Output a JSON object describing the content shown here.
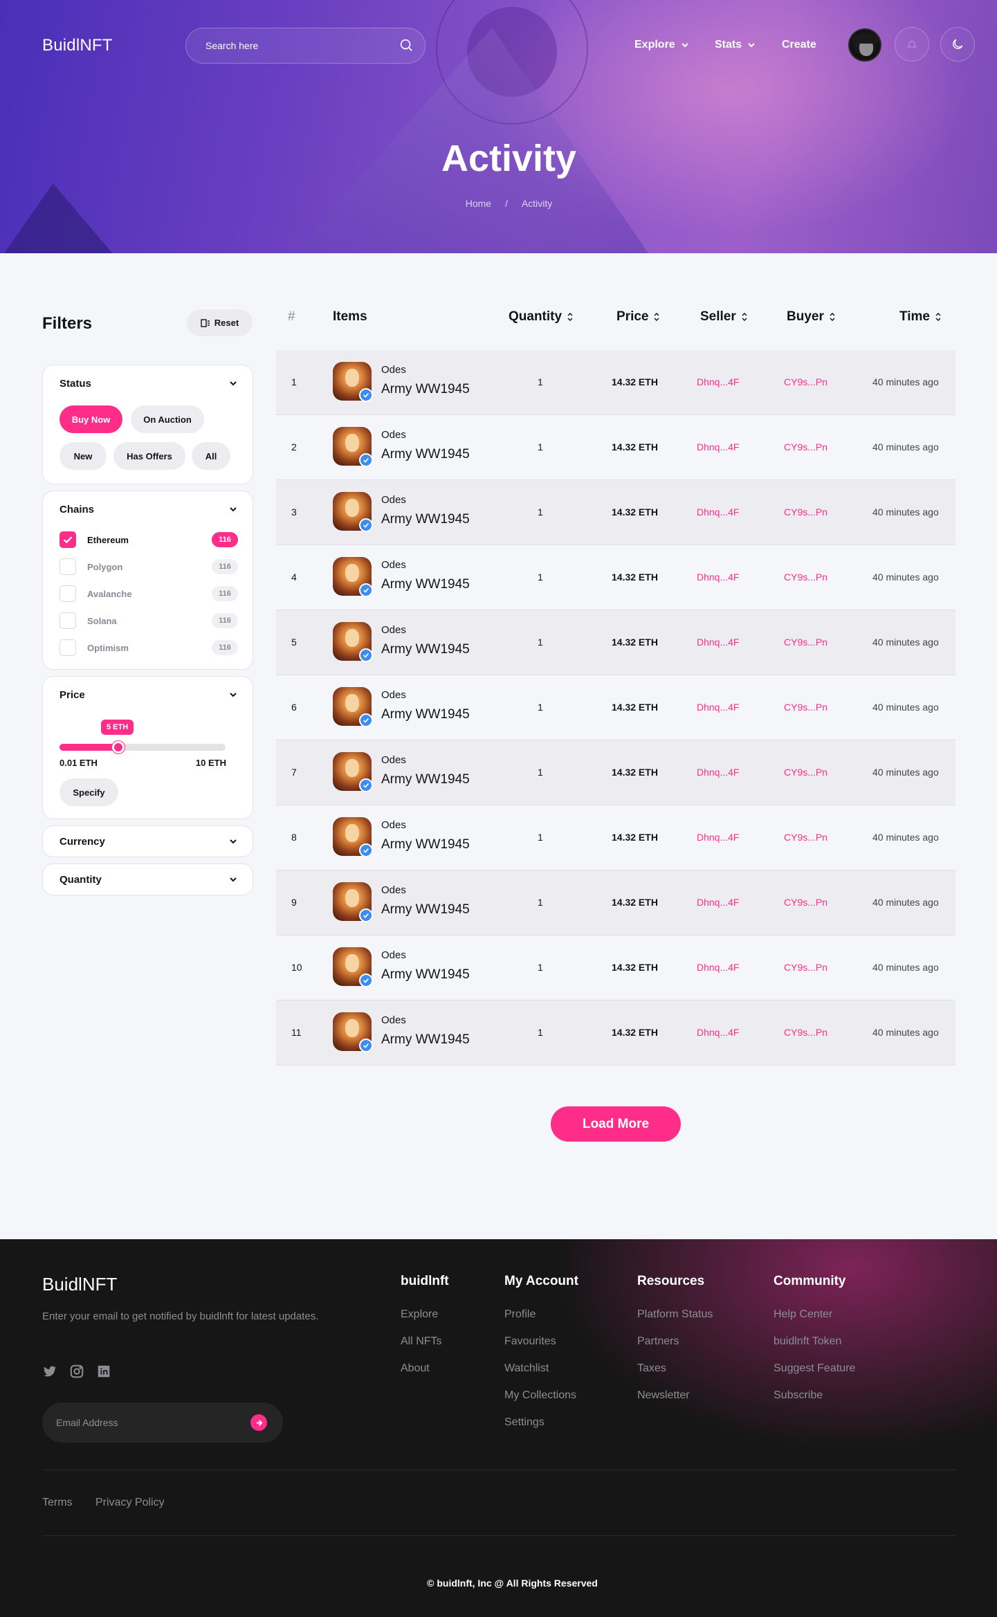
{
  "header": {
    "brand": "BuidlNFT",
    "search_placeholder": "Search here",
    "nav": [
      {
        "label": "Explore"
      },
      {
        "label": "Stats"
      },
      {
        "label": "Create"
      }
    ]
  },
  "hero": {
    "title": "Activity",
    "breadcrumb": [
      "Home",
      "/",
      "Activity"
    ]
  },
  "filters": {
    "title": "Filters",
    "reset_label": "Reset",
    "status": {
      "label": "Status",
      "chips": [
        "Buy Now",
        "On Auction",
        "New",
        "Has Offers",
        "All"
      ],
      "selected": "Buy Now"
    },
    "chains": {
      "label": "Chains",
      "items": [
        {
          "name": "Ethereum",
          "count": "116",
          "checked": true
        },
        {
          "name": "Polygon",
          "count": "116",
          "checked": false
        },
        {
          "name": "Avalanche",
          "count": "116",
          "checked": false
        },
        {
          "name": "Solana",
          "count": "116",
          "checked": false
        },
        {
          "name": "Optimism",
          "count": "116",
          "checked": false
        }
      ]
    },
    "price": {
      "label": "Price",
      "tooltip": "5 ETH",
      "min_label": "0.01 ETH",
      "max_label": "10 ETH",
      "fill_fraction": 0.5,
      "specify_label": "Specify"
    },
    "currency_label": "Currency",
    "quantity_label": "Quantity"
  },
  "table": {
    "headers": {
      "num": "#",
      "items": "Items",
      "quantity": "Quantity",
      "price": "Price",
      "seller": "Seller",
      "buyer": "Buyer",
      "time": "Time"
    },
    "rows": [
      {
        "num": "1",
        "collection": "Odes",
        "item": "Army WW1945",
        "quantity": "1",
        "price": "14.32 ETH",
        "seller": "Dhnq...4F",
        "buyer": "CY9s...Pn",
        "time": "40 minutes ago"
      },
      {
        "num": "2",
        "collection": "Odes",
        "item": "Army WW1945",
        "quantity": "1",
        "price": "14.32 ETH",
        "seller": "Dhnq...4F",
        "buyer": "CY9s...Pn",
        "time": "40 minutes ago"
      },
      {
        "num": "3",
        "collection": "Odes",
        "item": "Army WW1945",
        "quantity": "1",
        "price": "14.32 ETH",
        "seller": "Dhnq...4F",
        "buyer": "CY9s...Pn",
        "time": "40 minutes ago"
      },
      {
        "num": "4",
        "collection": "Odes",
        "item": "Army WW1945",
        "quantity": "1",
        "price": "14.32 ETH",
        "seller": "Dhnq...4F",
        "buyer": "CY9s...Pn",
        "time": "40 minutes ago"
      },
      {
        "num": "5",
        "collection": "Odes",
        "item": "Army WW1945",
        "quantity": "1",
        "price": "14.32 ETH",
        "seller": "Dhnq...4F",
        "buyer": "CY9s...Pn",
        "time": "40 minutes ago"
      },
      {
        "num": "6",
        "collection": "Odes",
        "item": "Army WW1945",
        "quantity": "1",
        "price": "14.32 ETH",
        "seller": "Dhnq...4F",
        "buyer": "CY9s...Pn",
        "time": "40 minutes ago"
      },
      {
        "num": "7",
        "collection": "Odes",
        "item": "Army WW1945",
        "quantity": "1",
        "price": "14.32 ETH",
        "seller": "Dhnq...4F",
        "buyer": "CY9s...Pn",
        "time": "40 minutes ago"
      },
      {
        "num": "8",
        "collection": "Odes",
        "item": "Army WW1945",
        "quantity": "1",
        "price": "14.32 ETH",
        "seller": "Dhnq...4F",
        "buyer": "CY9s...Pn",
        "time": "40 minutes ago"
      },
      {
        "num": "9",
        "collection": "Odes",
        "item": "Army WW1945",
        "quantity": "1",
        "price": "14.32 ETH",
        "seller": "Dhnq...4F",
        "buyer": "CY9s...Pn",
        "time": "40 minutes ago"
      },
      {
        "num": "10",
        "collection": "Odes",
        "item": "Army WW1945",
        "quantity": "1",
        "price": "14.32 ETH",
        "seller": "Dhnq...4F",
        "buyer": "CY9s...Pn",
        "time": "40 minutes ago"
      },
      {
        "num": "11",
        "collection": "Odes",
        "item": "Army WW1945",
        "quantity": "1",
        "price": "14.32 ETH",
        "seller": "Dhnq...4F",
        "buyer": "CY9s...Pn",
        "time": "40 minutes ago"
      }
    ],
    "load_more_label": "Load More"
  },
  "footer": {
    "brand": "BuidlNFT",
    "description": "Enter your email to get notified by buidlnft for latest updates.",
    "email_placeholder": "Email Address",
    "columns": [
      {
        "title": "buidlnft",
        "links": [
          "Explore",
          "All NFTs",
          "About"
        ]
      },
      {
        "title": "My Account",
        "links": [
          "Profile",
          "Favourites",
          "Watchlist",
          "My Collections",
          "Settings"
        ]
      },
      {
        "title": "Resources",
        "links": [
          "Platform Status",
          "Partners",
          "Taxes",
          "Newsletter"
        ]
      },
      {
        "title": "Community",
        "links": [
          "Help Center",
          "buidlnft Token",
          "Suggest Feature",
          "Subscribe"
        ]
      }
    ],
    "legal": [
      "Terms",
      "Privacy Policy"
    ],
    "copyright": "© buidlnft, Inc @ All Rights Reserved"
  },
  "theme": {
    "accent": "#ff2d8a",
    "verified": "#3b8cf5",
    "footer_bg": "#171616"
  }
}
